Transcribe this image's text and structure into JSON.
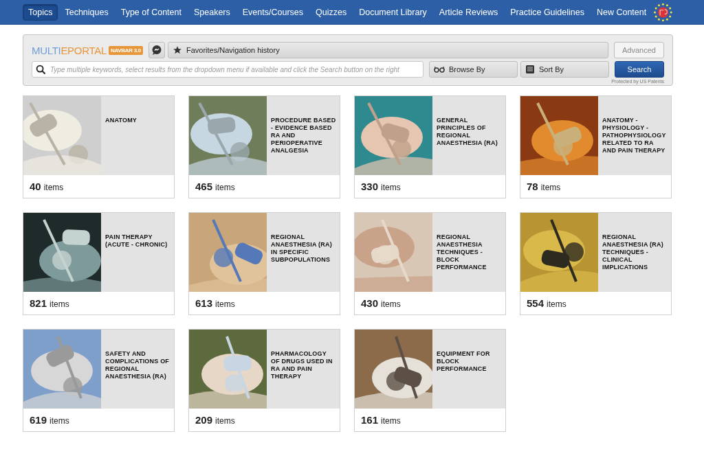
{
  "nav": {
    "items": [
      {
        "label": "Topics",
        "selected": true
      },
      {
        "label": "Techniques",
        "selected": false
      },
      {
        "label": "Type of Content",
        "selected": false
      },
      {
        "label": "Speakers",
        "selected": false
      },
      {
        "label": "Events/Courses",
        "selected": false
      },
      {
        "label": "Quizzes",
        "selected": false
      },
      {
        "label": "Document Library",
        "selected": false
      },
      {
        "label": "Article Reviews",
        "selected": false
      },
      {
        "label": "Practice Guidelines",
        "selected": false
      },
      {
        "label": "New Content",
        "selected": false
      }
    ]
  },
  "toolbar": {
    "logo_part_1": "MULTI",
    "logo_part_2": "EPORTAL",
    "logo_badge": "NAVBAR 3.0",
    "favorites": "Favorites/Navigation history",
    "advanced": "Advanced",
    "search_placeholder": "Type multiple keywords, select results from the dropdown menu if available and click the Search button on the right",
    "browse_by": "Browse By",
    "sort_by": "Sort By",
    "search_button": "Search",
    "patent_note": "Protected by US Patents"
  },
  "topics": [
    {
      "title": "ANATOMY",
      "count": "40",
      "unit": "items",
      "kind": "picture"
    },
    {
      "title": "PROCEDURE BASED - EVIDENCE BASED RA AND PERIOPERATIVE ANALGESIA",
      "count": "465",
      "unit": "items",
      "kind": "picture"
    },
    {
      "title": "GENERAL PRINCIPLES OF REGIONAL ANAESTHESIA (RA)",
      "count": "330",
      "unit": "items",
      "kind": "picture"
    },
    {
      "title": "ANATOMY - PHYSIOLOGY - PATHOPHYSIOLOGY RELATED TO RA AND PAIN THERAPY",
      "count": "78",
      "unit": "items",
      "kind": "picture"
    },
    {
      "title": "PAIN THERAPY (ACUTE - CHRONIC)",
      "count": "821",
      "unit": "items",
      "kind": "picture"
    },
    {
      "title": "REGIONAL ANAESTHESIA (RA) IN SPECIFIC SUBPOPULATIONS",
      "count": "613",
      "unit": "items",
      "kind": "picture"
    },
    {
      "title": "REGIONAL ANAESTHESIA TECHNIQUES - BLOCK PERFORMANCE",
      "count": "430",
      "unit": "items",
      "kind": "picture"
    },
    {
      "title": "REGIONAL ANAESTHESIA (RA) TECHNIQUES - CLINICAL IMPLICATIONS",
      "count": "554",
      "unit": "items",
      "kind": "picture"
    },
    {
      "title": "SAFETY AND COMPLICATIONS OF REGIONAL ANAESTHESIA (RA)",
      "count": "619",
      "unit": "items",
      "kind": "picture"
    },
    {
      "title": "PHARMACOLOGY OF DRUGS USED IN RA AND PAIN THERAPY",
      "count": "209",
      "unit": "items",
      "kind": "picture"
    },
    {
      "title": "EQUIPMENT FOR BLOCK PERFORMANCE",
      "count": "161",
      "unit": "items",
      "kind": "picture"
    }
  ]
}
